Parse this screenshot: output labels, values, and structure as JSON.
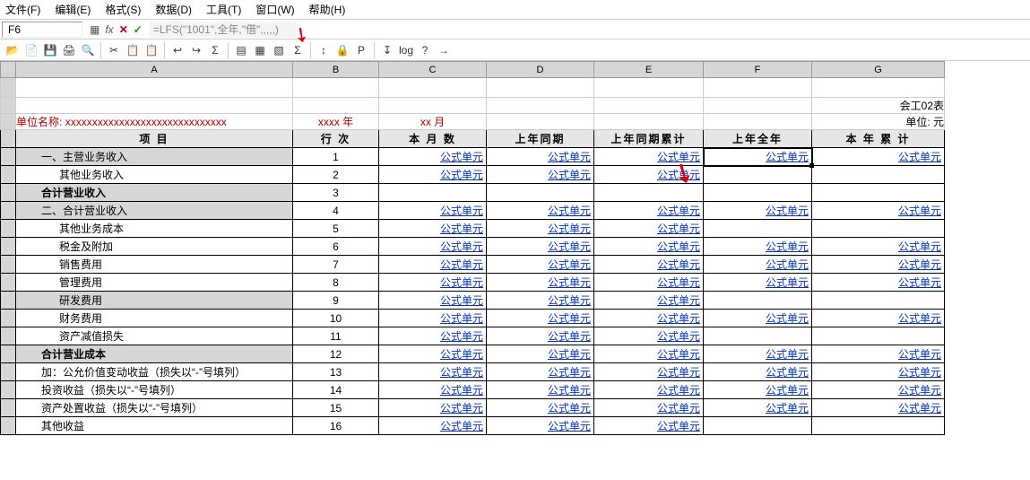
{
  "menu": {
    "file": "文件(F)",
    "edit": "编辑(E)",
    "format": "格式(S)",
    "data": "数据(D)",
    "tool": "工具(T)",
    "window": "窗口(W)",
    "help": "帮助(H)"
  },
  "cellRef": "F6",
  "formula": "=LFS(\"1001\",全年,\"借\",,,,,)",
  "toolbarIcons": [
    "📂",
    "📄",
    "💾",
    "🖨",
    "🔍",
    "✂",
    "📋",
    "📋",
    "↩",
    "↪",
    "Σ",
    "▤",
    "▦",
    "▧",
    "Σ",
    "↕",
    "🔒",
    "P",
    "↧",
    "log",
    "?",
    "→"
  ],
  "colLabels": [
    "A",
    "B",
    "C",
    "D",
    "E",
    "F",
    "G"
  ],
  "unitLabel": "单位名称:",
  "unitValue": "xxxxxxxxxxxxxxxxxxxxxxxxxxxxxx",
  "yearLabel": "xxxx  年",
  "monthLabel": "xx  月",
  "formCode": "会工02表",
  "unitYuan": "单位:  元",
  "headers": {
    "item": "项        目",
    "row": "行    次",
    "month": "本  月  数",
    "lastSame": "上年同期",
    "lastAccum": "上年同期累计",
    "lastYear": "上年全年",
    "yearAccum": "本 年 累 计"
  },
  "lnkTxt": "公式单元",
  "rows": [
    {
      "a": "一、主营业务收入",
      "b": "1",
      "shade": true,
      "indent": 1,
      "c": true,
      "d": true,
      "e": true,
      "f": true,
      "g": true,
      "fsel": true
    },
    {
      "a": "其他业务收入",
      "b": "2",
      "indent": 2,
      "c": true,
      "d": true,
      "e": true
    },
    {
      "a": "合计营业收入",
      "b": "3",
      "shade": true,
      "bold": true,
      "indent": 1
    },
    {
      "a": "二、合计营业收入",
      "b": "4",
      "shade": true,
      "indent": 1,
      "c": true,
      "d": true,
      "e": true,
      "f": true,
      "g": true
    },
    {
      "a": "其他业务成本",
      "b": "5",
      "indent": 2,
      "c": true,
      "d": true,
      "e": true
    },
    {
      "a": "税金及附加",
      "b": "6",
      "indent": 2,
      "c": true,
      "d": true,
      "e": true,
      "f": true,
      "g": true
    },
    {
      "a": "销售费用",
      "b": "7",
      "indent": 2,
      "c": true,
      "d": true,
      "e": true,
      "f": true,
      "g": true
    },
    {
      "a": "管理费用",
      "b": "8",
      "indent": 2,
      "c": true,
      "d": true,
      "e": true,
      "f": true,
      "g": true
    },
    {
      "a": "研发费用",
      "b": "9",
      "shade": true,
      "indent": 2,
      "c": true,
      "d": true,
      "e": true
    },
    {
      "a": "财务费用",
      "b": "10",
      "indent": 2,
      "c": true,
      "d": true,
      "e": true,
      "f": true,
      "g": true
    },
    {
      "a": "资产减值损失",
      "b": "11",
      "indent": 2,
      "c": true,
      "d": true,
      "e": true
    },
    {
      "a": "合计营业成本",
      "b": "12",
      "shade": true,
      "bold": true,
      "indent": 1,
      "c": true,
      "d": true,
      "e": true,
      "f": true,
      "g": true
    },
    {
      "a": "加：公允价值变动收益（损失以“-”号填列）",
      "b": "13",
      "indent": 1,
      "c": true,
      "d": true,
      "e": true,
      "f": true,
      "g": true
    },
    {
      "a": "投资收益（损失以“-”号填列）",
      "b": "14",
      "indent": 1,
      "c": true,
      "d": true,
      "e": true,
      "f": true,
      "g": true
    },
    {
      "a": "资产处置收益（损失以“-”号填列）",
      "b": "15",
      "indent": 1,
      "c": true,
      "d": true,
      "e": true,
      "f": true,
      "g": true
    },
    {
      "a": "其他收益",
      "b": "16",
      "indent": 1,
      "c": true,
      "d": true,
      "e": true
    }
  ]
}
